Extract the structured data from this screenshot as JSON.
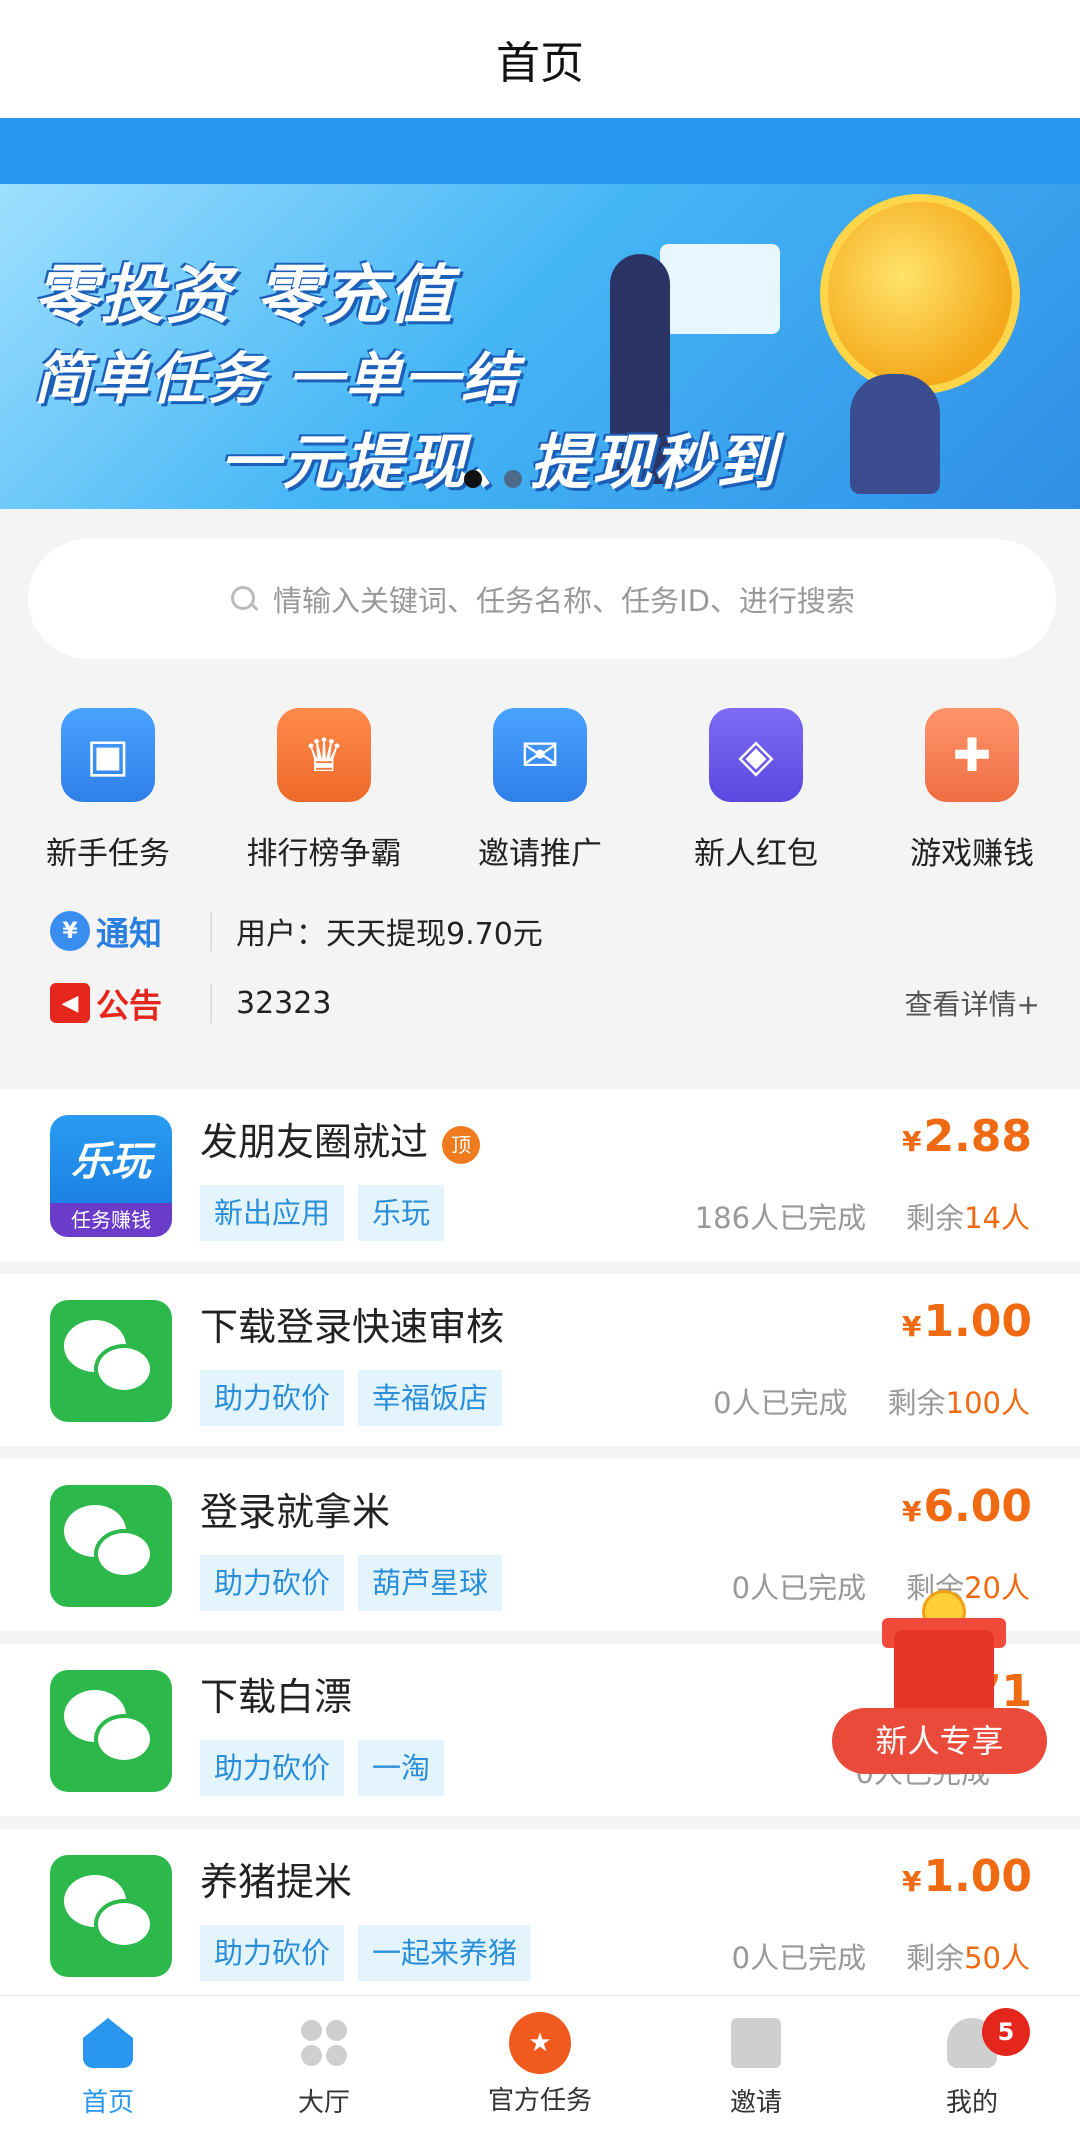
{
  "header": {
    "title": "首页"
  },
  "banner": {
    "line1": "零投资  零充值",
    "line2": "简单任务  一单一结",
    "line3": "一元提现、提现秒到"
  },
  "search": {
    "placeholder": "情输入关键词、任务名称、任务ID、进行搜索"
  },
  "quick_actions": [
    {
      "label": "新手任务",
      "icon": "gift-icon",
      "color": "#3a8df0"
    },
    {
      "label": "排行榜争霸",
      "icon": "trophy-icon",
      "color": "#f07a2e"
    },
    {
      "label": "邀请推广",
      "icon": "envelope-icon",
      "color": "#3a8df0"
    },
    {
      "label": "新人红包",
      "icon": "red-packet-icon",
      "color": "#6a5ae8"
    },
    {
      "label": "游戏赚钱",
      "icon": "gamepad-icon",
      "color": "#f07a4e"
    }
  ],
  "notice": {
    "notify_tag": "通知",
    "notify_text": "用户：天天提现9.70元",
    "announce_tag": "公告",
    "announce_text": "32323",
    "more": "查看详情+"
  },
  "tasks": [
    {
      "title": "发朋友圈就过",
      "top_badge": "顶",
      "tags": [
        "新出应用",
        "乐玩"
      ],
      "currency": "¥",
      "price": "2.88",
      "completed": "186人已完成",
      "remain_prefix": "剩余",
      "remain": "14人",
      "logo": "lewan-logo",
      "logo_top": "乐玩",
      "logo_bottom": "任务赚钱"
    },
    {
      "title": "下载登录快速审核",
      "tags": [
        "助力砍价",
        "幸福饭店"
      ],
      "currency": "¥",
      "price": "1.00",
      "completed": "0人已完成",
      "remain_prefix": "剩余",
      "remain": "100人",
      "logo": "wechat-logo"
    },
    {
      "title": "登录就拿米",
      "tags": [
        "助力砍价",
        "葫芦星球"
      ],
      "currency": "¥",
      "price": "6.00",
      "completed": "0人已完成",
      "remain_prefix": "剩余",
      "remain": "20人",
      "logo": "wechat-logo"
    },
    {
      "title": "下载白漂",
      "tags": [
        "助力砍价",
        "一淘"
      ],
      "currency": "",
      "price": "71",
      "completed": "0人已完成",
      "remain_prefix": "",
      "remain": "",
      "logo": "wechat-logo"
    },
    {
      "title": "养猪提米",
      "tags": [
        "助力砍价",
        "一起来养猪"
      ],
      "currency": "¥",
      "price": "1.00",
      "completed": "0人已完成",
      "remain_prefix": "剩余",
      "remain": "50人",
      "logo": "wechat-logo"
    }
  ],
  "promo": {
    "label": "新人专享"
  },
  "tabbar": [
    {
      "label": "首页",
      "active": true
    },
    {
      "label": "大厅",
      "active": false
    },
    {
      "label": "官方任务",
      "active": false
    },
    {
      "label": "邀请",
      "active": false
    },
    {
      "label": "我的",
      "active": false,
      "badge": "5"
    }
  ]
}
